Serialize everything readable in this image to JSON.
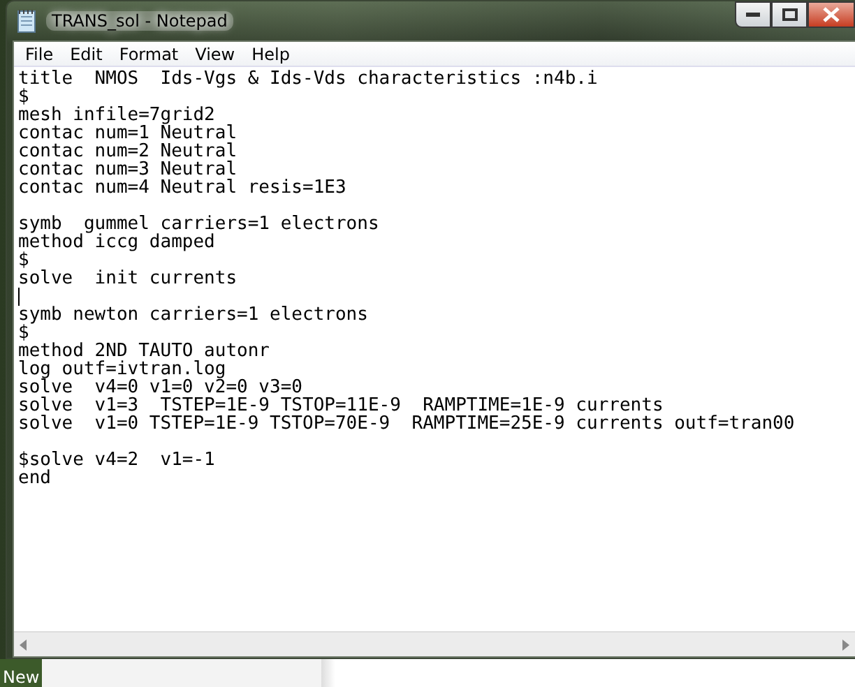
{
  "window": {
    "title": "TRANS_sol - Notepad"
  },
  "menu": [
    "File",
    "Edit",
    "Format",
    "View",
    "Help"
  ],
  "editor": {
    "blocks": [
      {
        "kind": "text",
        "text": "title  NMOS  Ids-Vgs & Ids-Vds characteristics :n4b.i\n$\nmesh infile=7grid2\ncontac num=1 Neutral\ncontac num=2 Neutral\ncontac num=3 Neutral\ncontac num=4 Neutral resis=1E3\n\nsymb  gummel carriers=1 electrons\nmethod iccg damped\n$\nsolve  init currents"
      },
      {
        "kind": "caret"
      },
      {
        "kind": "text",
        "text": "symb newton carriers=1 electrons\n$\nmethod 2ND TAUTO autonr\nlog outf=ivtran.log\nsolve  v4=0 v1=0 v2=0 v3=0\nsolve  v1=3  TSTEP=1E-9 TSTOP=11E-9  RAMPTIME=1E-9 currents\nsolve  v1=0 TSTEP=1E-9 TSTOP=70E-9  RAMPTIME=25E-9 currents outf=tran00\n\n$solve v4=2  v1=-1\nend"
      }
    ]
  },
  "taskbar": {
    "label": "New"
  }
}
